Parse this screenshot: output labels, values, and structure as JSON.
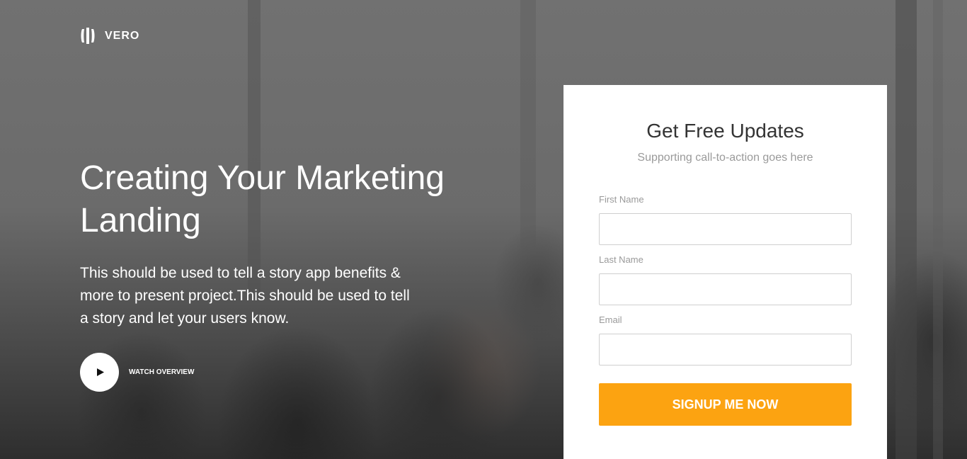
{
  "brand": {
    "name": "VERO",
    "logo_icon": "vero-logo-icon"
  },
  "hero": {
    "headline": "Creating Your Marketing Landing",
    "description": "This should be used to tell a story app benefits & more to present project.This should be used to tell a story and let your users know.",
    "watch_label": "WATCH OVERVIEW",
    "play_icon": "play-icon"
  },
  "form": {
    "title": "Get Free Updates",
    "subtitle": "Supporting call-to-action goes here",
    "fields": [
      {
        "label": "First Name",
        "value": "",
        "placeholder": ""
      },
      {
        "label": "Last Name",
        "value": "",
        "placeholder": ""
      },
      {
        "label": "Email",
        "value": "",
        "placeholder": ""
      }
    ],
    "submit_label": "SIGNUP ME NOW"
  },
  "colors": {
    "accent": "#fca311",
    "text_light": "#ffffff",
    "text_muted": "#9a9a9a",
    "card_background": "#ffffff"
  }
}
